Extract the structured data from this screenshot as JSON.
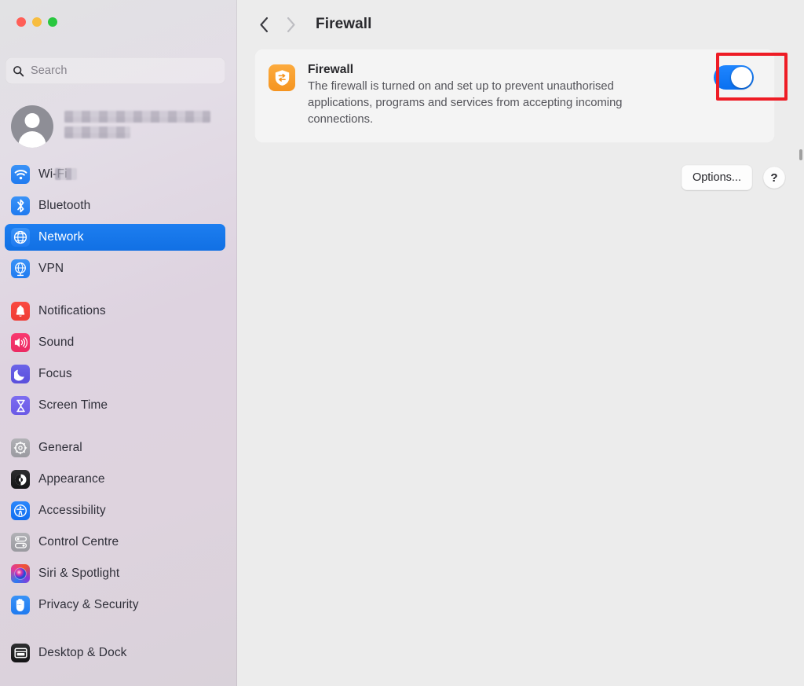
{
  "window": {
    "traffic_lights": [
      {
        "name": "close",
        "color": "#ff5f57"
      },
      {
        "name": "minimize",
        "color": "#f7bd3f"
      },
      {
        "name": "zoom",
        "color": "#29c73f"
      }
    ]
  },
  "sidebar": {
    "search": {
      "placeholder": "Search",
      "value": "",
      "icon": "search-icon"
    },
    "profile": {
      "name_redacted": true,
      "subtitle_redacted": true,
      "avatar_icon": "person-avatar-icon"
    },
    "groups": [
      {
        "items": [
          {
            "label": "Wi-Fi",
            "icon": "wifi-icon",
            "icon_class": "ic-wifi",
            "selected": false,
            "redacted_suffix": true
          },
          {
            "label": "Bluetooth",
            "icon": "bluetooth-icon",
            "icon_class": "ic-bt",
            "selected": false
          },
          {
            "label": "Network",
            "icon": "globe-icon",
            "icon_class": "ic-net",
            "selected": true
          },
          {
            "label": "VPN",
            "icon": "vpn-globe-icon",
            "icon_class": "ic-vpn",
            "selected": false
          }
        ]
      },
      {
        "items": [
          {
            "label": "Notifications",
            "icon": "bell-icon",
            "icon_class": "ic-notif",
            "selected": false
          },
          {
            "label": "Sound",
            "icon": "speaker-icon",
            "icon_class": "ic-sound",
            "selected": false
          },
          {
            "label": "Focus",
            "icon": "moon-icon",
            "icon_class": "ic-focus",
            "selected": false
          },
          {
            "label": "Screen Time",
            "icon": "hourglass-icon",
            "icon_class": "ic-screen",
            "selected": false
          }
        ]
      },
      {
        "items": [
          {
            "label": "General",
            "icon": "gear-icon",
            "icon_class": "ic-general",
            "selected": false
          },
          {
            "label": "Appearance",
            "icon": "contrast-icon",
            "icon_class": "ic-appear",
            "selected": false
          },
          {
            "label": "Accessibility",
            "icon": "accessibility-icon",
            "icon_class": "ic-access",
            "selected": false
          },
          {
            "label": "Control Centre",
            "icon": "sliders-icon",
            "icon_class": "ic-control",
            "selected": false
          },
          {
            "label": "Siri & Spotlight",
            "icon": "siri-orb-icon",
            "icon_class": "ic-siri",
            "selected": false
          },
          {
            "label": "Privacy & Security",
            "icon": "hand-icon",
            "icon_class": "ic-privacy",
            "selected": false
          }
        ]
      },
      {
        "items": [
          {
            "label": "Desktop & Dock",
            "icon": "desktop-icon",
            "icon_class": "ic-desktop",
            "selected": false
          }
        ]
      }
    ]
  },
  "toolbar": {
    "back_icon": "chevron-left-icon",
    "forward_icon": "chevron-right-icon",
    "back_enabled": true,
    "forward_enabled": false,
    "title": "Firewall"
  },
  "firewall_card": {
    "icon": "firewall-shield-icon",
    "title": "Firewall",
    "description": "The firewall is turned on and set up to prevent unauthorised applications, programs and services from accepting incoming connections.",
    "toggle": {
      "name": "firewall-toggle",
      "state": "on",
      "accent_color": "#0a70f0"
    },
    "annotation": {
      "shape": "rectangle",
      "color": "#ee1c25",
      "target": "firewall-toggle"
    }
  },
  "actions": {
    "options_label": "Options...",
    "help_label": "?"
  }
}
